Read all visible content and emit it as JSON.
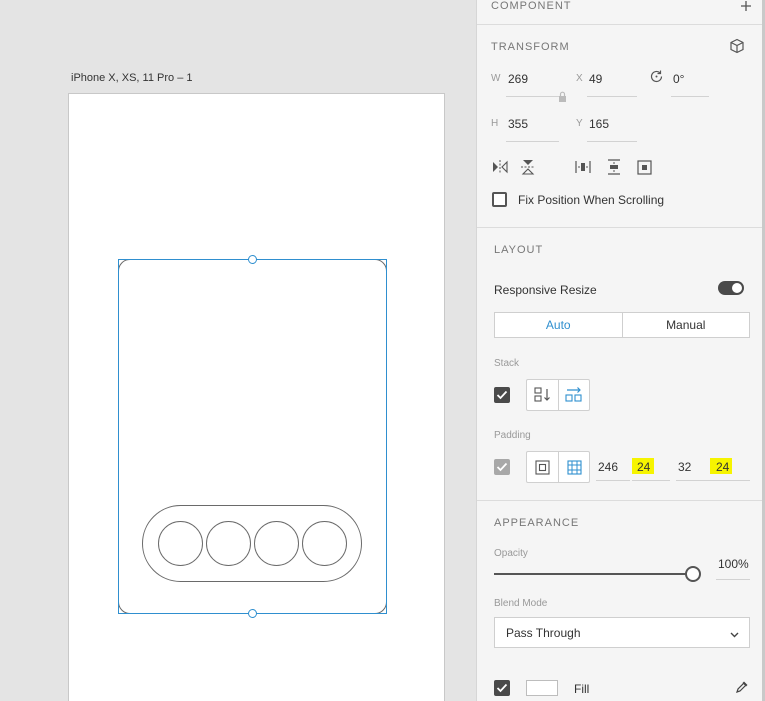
{
  "canvas": {
    "artboard_title": "iPhone X, XS, 11 Pro – 1"
  },
  "panel": {
    "component": {
      "title": "COMPONENT",
      "add_icon": "plus-icon"
    },
    "transform": {
      "title": "TRANSFORM",
      "w_label": "W",
      "w_value": "269",
      "x_label": "X",
      "x_value": "49",
      "rotation_value": "0°",
      "h_label": "H",
      "h_value": "355",
      "y_label": "Y",
      "y_value": "165",
      "fix_position_label": "Fix Position When Scrolling",
      "fix_position_checked": false
    },
    "layout": {
      "title": "LAYOUT",
      "responsive_resize_label": "Responsive Resize",
      "responsive_resize_on": true,
      "mode_auto": "Auto",
      "mode_manual": "Manual",
      "mode_selected": "Auto",
      "stack_label": "Stack",
      "stack_checked": true,
      "padding_label": "Padding",
      "padding_checked": true,
      "padding_values": [
        "246",
        "24",
        "32",
        "24"
      ]
    },
    "appearance": {
      "title": "APPEARANCE",
      "opacity_label": "Opacity",
      "opacity_value": "100%",
      "opacity_fraction": 1.0,
      "blend_mode_label": "Blend Mode",
      "blend_mode_value": "Pass Through",
      "fill_label": "Fill",
      "fill_checked": true,
      "fill_color": "#ffffff"
    }
  },
  "colors": {
    "accent": "#2f8fcf",
    "highlight": "#f6f400",
    "panel_bg": "#f5f5f5",
    "canvas_bg": "#e4e4e4"
  }
}
